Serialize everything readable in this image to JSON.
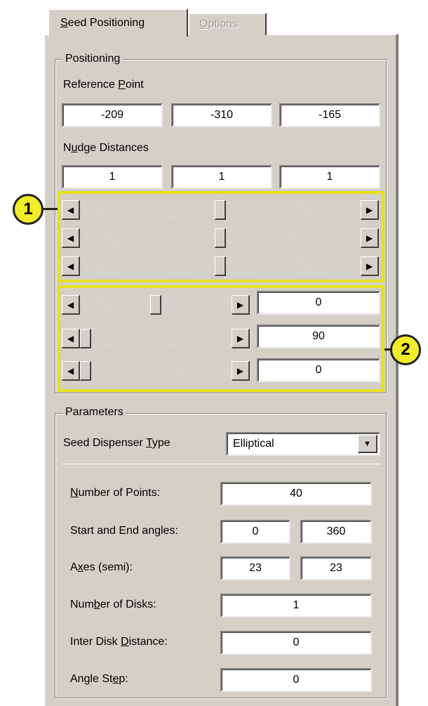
{
  "tabs": {
    "active": {
      "pre": "",
      "key": "S",
      "post": "eed Positioning"
    },
    "inactive": {
      "pre": "",
      "key": "O",
      "post": "ptions"
    }
  },
  "positioning": {
    "legend": "Positioning",
    "reference_point": {
      "pre": "Reference ",
      "key": "P",
      "post": "oint",
      "values": [
        "-209",
        "-310",
        "-165"
      ]
    },
    "nudge_distances": {
      "pre": "N",
      "key": "u",
      "post": "dge Distances",
      "values": [
        "1",
        "1",
        "1"
      ]
    },
    "position_sliders": [
      0.5,
      0.5,
      0.5
    ],
    "rotation_sliders": [
      {
        "value": "0",
        "level": 0.5
      },
      {
        "value": "90",
        "level": 0.0
      },
      {
        "value": "0",
        "level": 0.0
      }
    ]
  },
  "callouts": {
    "one": "1",
    "two": "2"
  },
  "parameters": {
    "legend": "Parameters",
    "dispenser_type": {
      "pre": "Seed Dispenser ",
      "key": "T",
      "post": "ype",
      "value": "Elliptical"
    },
    "number_of_points": {
      "pre": "",
      "key": "N",
      "post": "umber of Points:",
      "value": "40"
    },
    "start_end_angles": {
      "pre": "Start and End an",
      "key": "g",
      "post": "les:",
      "start": "0",
      "end": "360"
    },
    "axes": {
      "pre": "A",
      "key": "x",
      "post": "es (semi):",
      "a": "23",
      "b": "23"
    },
    "number_of_disks": {
      "pre": "Num",
      "key": "b",
      "post": "er of Disks:",
      "value": "1"
    },
    "inter_disk_distance": {
      "pre": "Inter Disk ",
      "key": "D",
      "post": "istance:",
      "value": "0"
    },
    "angle_step": {
      "pre": "Angle St",
      "key": "e",
      "post": "p:",
      "value": "0"
    }
  },
  "icons": {
    "left": "◀",
    "right": "▶",
    "down": "▼"
  },
  "colors": {
    "highlight": "#e6e01e",
    "callout": "#f2ec2a",
    "panel": "#d4d0c8"
  }
}
